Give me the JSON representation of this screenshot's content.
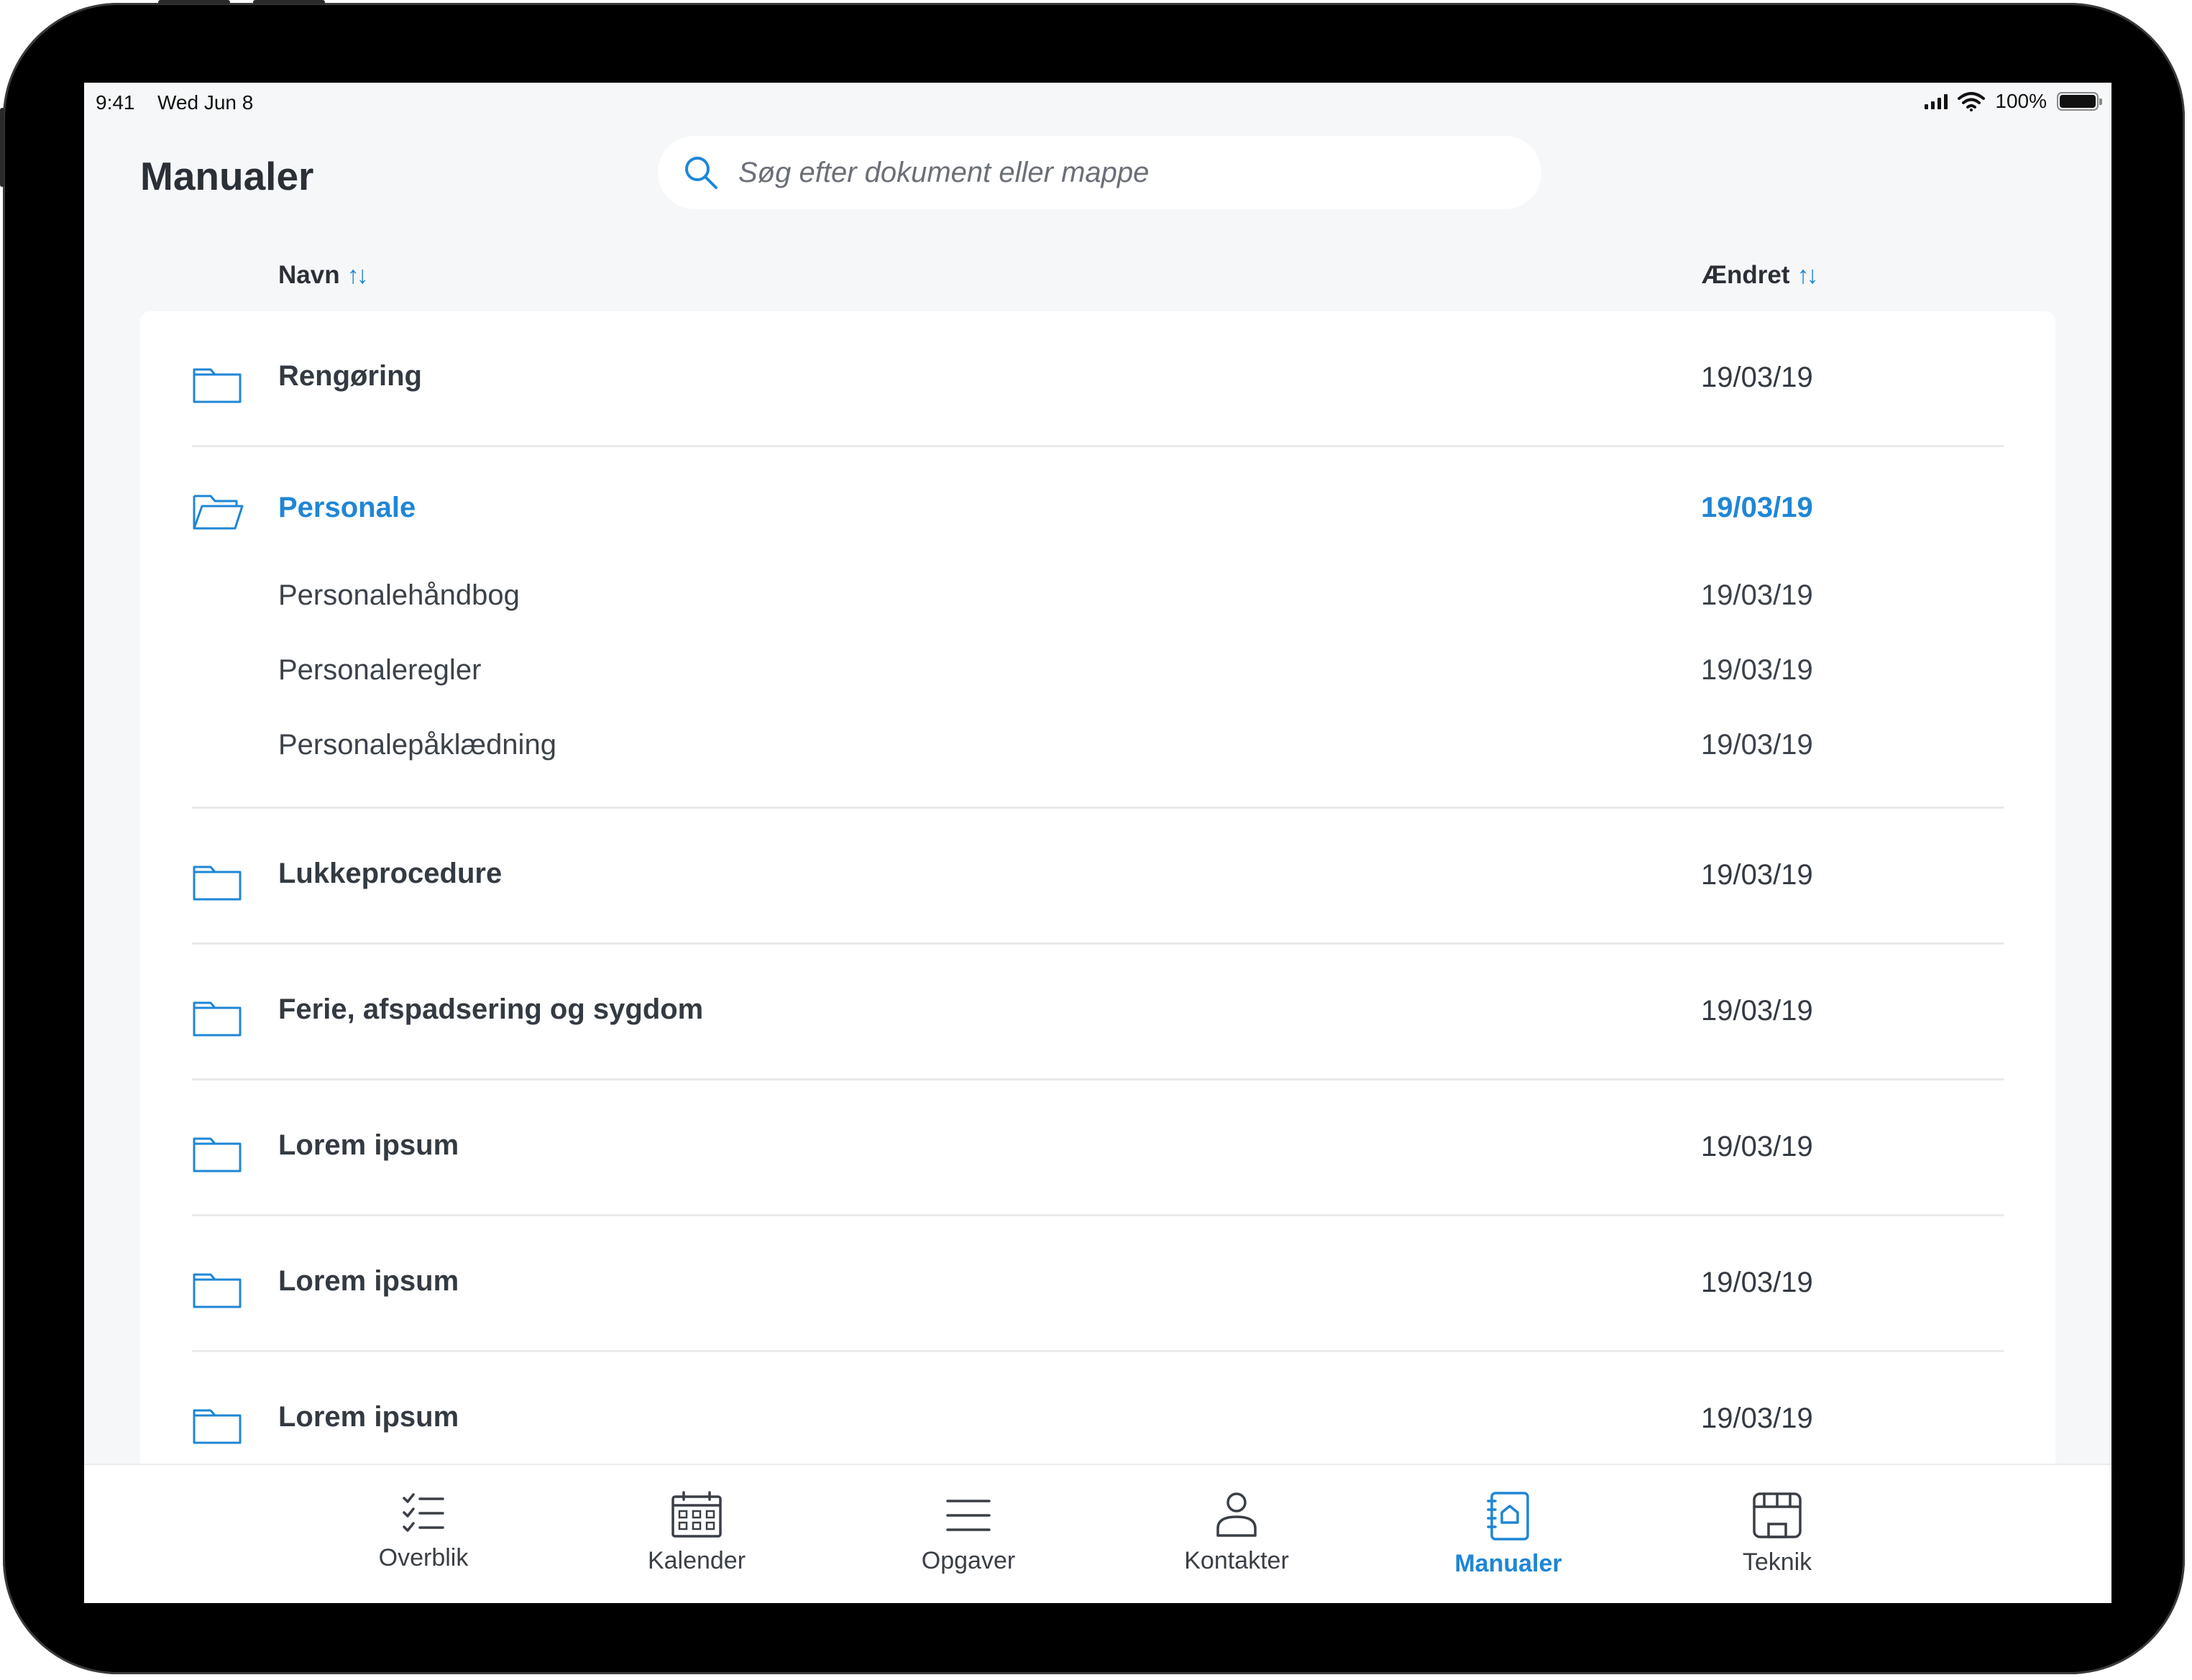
{
  "status_bar": {
    "time": "9:41",
    "date": "Wed Jun 8",
    "battery": "100%"
  },
  "header": {
    "title": "Manualer",
    "search_placeholder": "Søg efter dokument eller mappe"
  },
  "columns": {
    "name": "Navn",
    "changed": "Ændret"
  },
  "rows": [
    {
      "name": "Rengøring",
      "date": "19/03/19"
    },
    {
      "name": "Personale",
      "date": "19/03/19",
      "expanded": true,
      "children": [
        {
          "name": "Personalehåndbog",
          "date": "19/03/19"
        },
        {
          "name": "Personaleregler",
          "date": "19/03/19"
        },
        {
          "name": "Personalepåklædning",
          "date": "19/03/19"
        }
      ]
    },
    {
      "name": "Lukkeprocedure",
      "date": "19/03/19"
    },
    {
      "name": "Ferie, afspadsering og sygdom",
      "date": "19/03/19"
    },
    {
      "name": "Lorem ipsum",
      "date": "19/03/19"
    },
    {
      "name": "Lorem ipsum",
      "date": "19/03/19"
    },
    {
      "name": "Lorem ipsum",
      "date": "19/03/19"
    }
  ],
  "tabs": [
    {
      "label": "Overblik",
      "icon": "checklist-icon"
    },
    {
      "label": "Kalender",
      "icon": "calendar-icon"
    },
    {
      "label": "Opgaver",
      "icon": "menu-lines-icon"
    },
    {
      "label": "Kontakter",
      "icon": "person-icon"
    },
    {
      "label": "Manualer",
      "icon": "manual-book-icon",
      "active": true
    },
    {
      "label": "Teknik",
      "icon": "technical-icon"
    }
  ],
  "colors": {
    "accent": "#1f86d6",
    "text": "#343a42",
    "background": "#f6f7f8"
  }
}
